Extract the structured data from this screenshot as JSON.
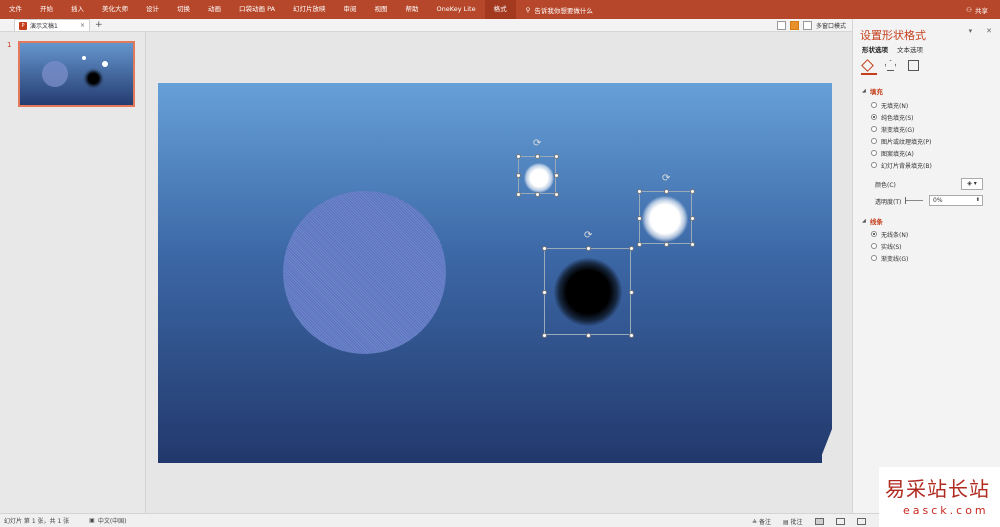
{
  "ribbon": {
    "tabs": [
      "文件",
      "开始",
      "插入",
      "美化大师",
      "设计",
      "切换",
      "动画",
      "口袋动画 PA",
      "幻灯片放映",
      "审阅",
      "视图",
      "帮助",
      "OneKey Lite",
      "格式"
    ],
    "active_tab": "格式",
    "tell_me": "告诉我你想要做什么",
    "share": "共享"
  },
  "doc_tabs": {
    "title": "演示文稿1",
    "close_glyph": "×",
    "new_tab_glyph": "+",
    "multi_window": "多窗口模式"
  },
  "thumbnails": {
    "slide_number": "1"
  },
  "format_pane": {
    "title": "设置形状格式",
    "tab_shape": "形状选项",
    "tab_text": "文本选项",
    "fill_section": "填充",
    "fill_options": [
      {
        "label": "无填充(N)",
        "selected": false
      },
      {
        "label": "纯色填充(S)",
        "selected": true
      },
      {
        "label": "渐变填充(G)",
        "selected": false
      },
      {
        "label": "图片或纹理填充(P)",
        "selected": false
      },
      {
        "label": "图案填充(A)",
        "selected": false
      },
      {
        "label": "幻灯片背景填充(B)",
        "selected": false
      }
    ],
    "color_label": "颜色(C)",
    "transparency_label": "透明度(T)",
    "transparency_value": "0%",
    "line_section": "线条",
    "line_options": [
      {
        "label": "无线条(N)",
        "selected": true
      },
      {
        "label": "实线(S)",
        "selected": false
      },
      {
        "label": "渐变线(G)",
        "selected": false
      }
    ]
  },
  "status": {
    "slide_info": "幻灯片 第 1 张，共 1 张",
    "language": "中文(中国)",
    "notes": "备注",
    "comments": "批注"
  },
  "watermark": {
    "cn": "易采站长站",
    "en": "easck.com"
  },
  "colors": {
    "ribbon": "#b7472a",
    "accent": "#c43e1c"
  }
}
